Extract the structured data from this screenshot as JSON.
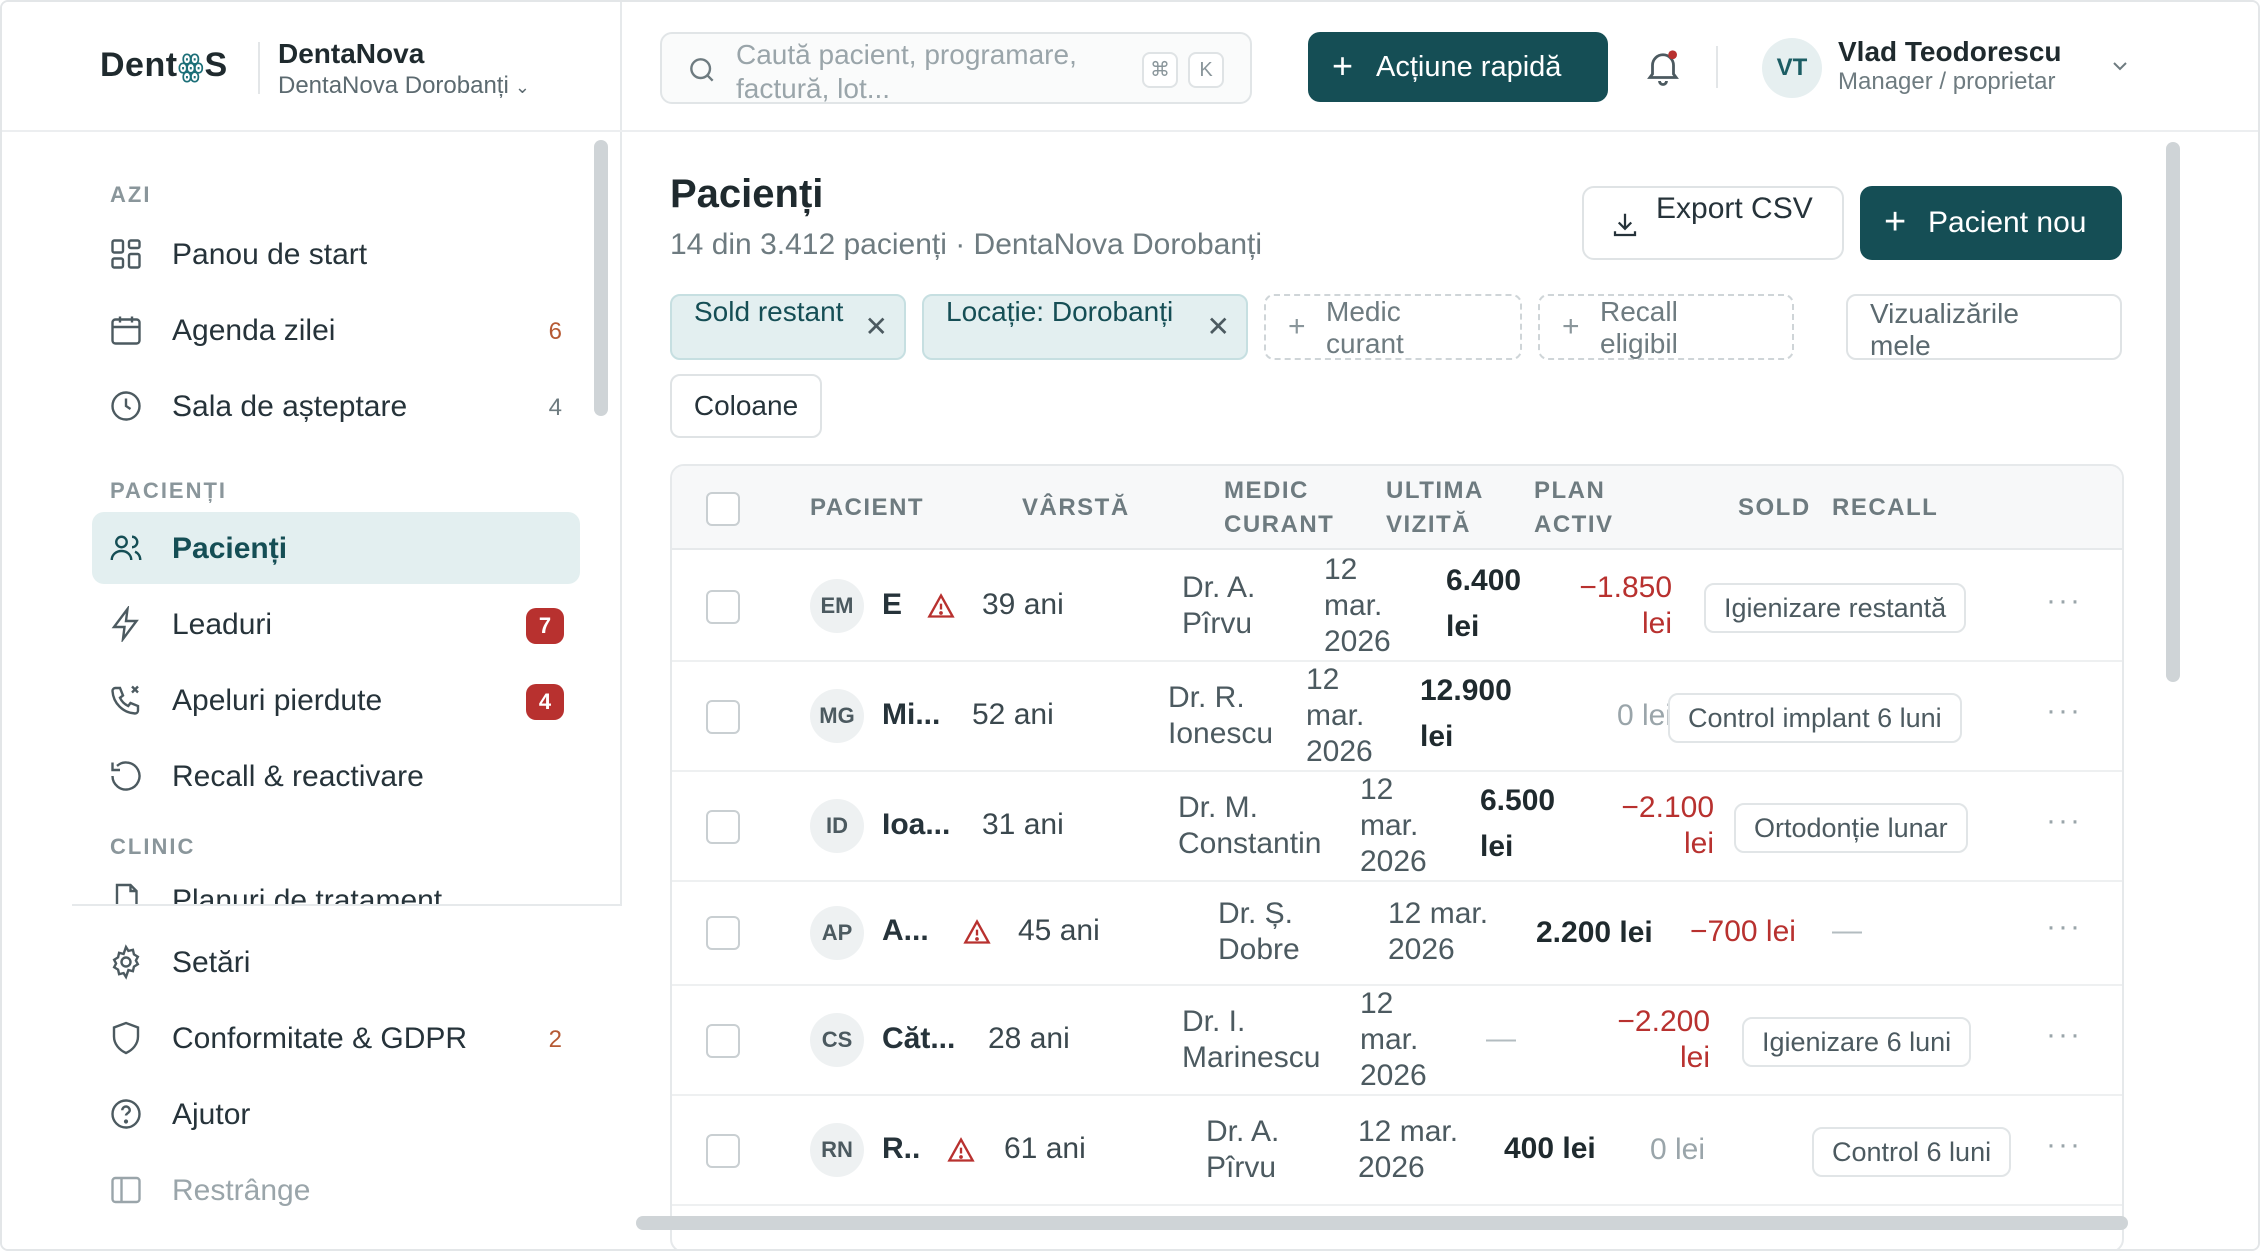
{
  "brand": {
    "logo_left": "Dent",
    "logo_mid": "ʘ",
    "logo_right": "S",
    "name": "DentaNova",
    "clinic": "DentaNova Dorobanți"
  },
  "search": {
    "placeholder": "Caută pacient, programare, factură, lot...",
    "kbd1": "⌘",
    "kbd2": "K"
  },
  "topbar": {
    "quick_action": "Acțiune rapidă",
    "user_initials": "VT",
    "user_name": "Vlad Teodorescu",
    "user_role": "Manager / proprietar"
  },
  "sidebar": {
    "sections": [
      "AZI",
      "PACIENȚI",
      "CLINIC"
    ],
    "items": [
      {
        "label": "Panou de start",
        "count": ""
      },
      {
        "label": "Agenda zilei",
        "count": "6"
      },
      {
        "label": "Sala de așteptare",
        "count": "4"
      },
      {
        "label": "Pacienți",
        "count": ""
      },
      {
        "label": "Leaduri",
        "count": "7"
      },
      {
        "label": "Apeluri pierdute",
        "count": "4"
      },
      {
        "label": "Recall & reactivare",
        "count": ""
      },
      {
        "label": "Planuri de tratament",
        "count": ""
      }
    ],
    "bottom": [
      {
        "label": "Setări",
        "count": ""
      },
      {
        "label": "Conformitate & GDPR",
        "count": "2"
      },
      {
        "label": "Ajutor",
        "count": ""
      },
      {
        "label": "Restrânge",
        "count": ""
      }
    ]
  },
  "page": {
    "title": "Pacienți",
    "subtitle": "14 din 3.412 pacienți · DentaNova Dorobanți",
    "export_label": "Export CSV",
    "new_label": "Pacient nou",
    "filters": [
      {
        "label": "Sold restant"
      },
      {
        "label": "Locație: Dorobanți"
      },
      {
        "label": "Medic curant"
      },
      {
        "label": "Recall eligibil"
      }
    ],
    "views_label": "Vizualizările mele",
    "columns_label": "Coloane"
  },
  "table": {
    "headers": {
      "patient": "PACIENT",
      "age": "VÂRSTĂ",
      "doctor": "MEDIC CURANT",
      "last_visit": "ULTIMA VIZITĂ",
      "plan": "PLAN ACTIV",
      "balance": "SOLD",
      "recall": "RECALL"
    },
    "rows": [
      {
        "initials": "EM",
        "name": "E",
        "alert": true,
        "age": "39 ani",
        "doctor": "Dr. A. Pîrvu",
        "last_visit": "12 mar. 2026",
        "plan": "6.400 lei",
        "balance": "−1.850 lei",
        "balance_type": "neg",
        "recall": "Igienizare restantă"
      },
      {
        "initials": "MG",
        "name": "Mi...",
        "alert": false,
        "age": "52 ani",
        "doctor": "Dr. R. Ionescu",
        "last_visit": "12 mar. 2026",
        "plan": "12.900 lei",
        "balance": "0 lei",
        "balance_type": "zero",
        "recall": "Control implant 6 luni"
      },
      {
        "initials": "ID",
        "name": "Ioa...",
        "alert": false,
        "age": "31 ani",
        "doctor": "Dr. M. Constantin",
        "last_visit": "12 mar. 2026",
        "plan": "6.500 lei",
        "balance": "−2.100 lei",
        "balance_type": "neg",
        "recall": "Ortodonție lunar"
      },
      {
        "initials": "AP",
        "name": "A...",
        "alert": true,
        "age": "45 ani",
        "doctor": "Dr. Ș. Dobre",
        "last_visit": "12 mar. 2026",
        "plan": "2.200 lei",
        "balance": "−700 lei",
        "balance_type": "neg",
        "recall": "—"
      },
      {
        "initials": "CS",
        "name": "Căt...",
        "alert": false,
        "age": "28 ani",
        "doctor": "Dr. I. Marinescu",
        "last_visit": "12 mar. 2026",
        "plan": "—",
        "balance": "−2.200 lei",
        "balance_type": "neg",
        "recall": "Igienizare 6 luni"
      },
      {
        "initials": "RN",
        "name": "R..",
        "alert": true,
        "age": "61 ani",
        "doctor": "Dr. A. Pîrvu",
        "last_visit": "12 mar. 2026",
        "plan": "400 lei",
        "balance": "0 lei",
        "balance_type": "zero",
        "recall": "Control 6 luni"
      }
    ],
    "row_menu": "···"
  },
  "colors": {
    "primary": "#154e55",
    "accent_bg": "#e3eff0",
    "danger": "#b8312f",
    "warning_count": "#b65a34"
  }
}
